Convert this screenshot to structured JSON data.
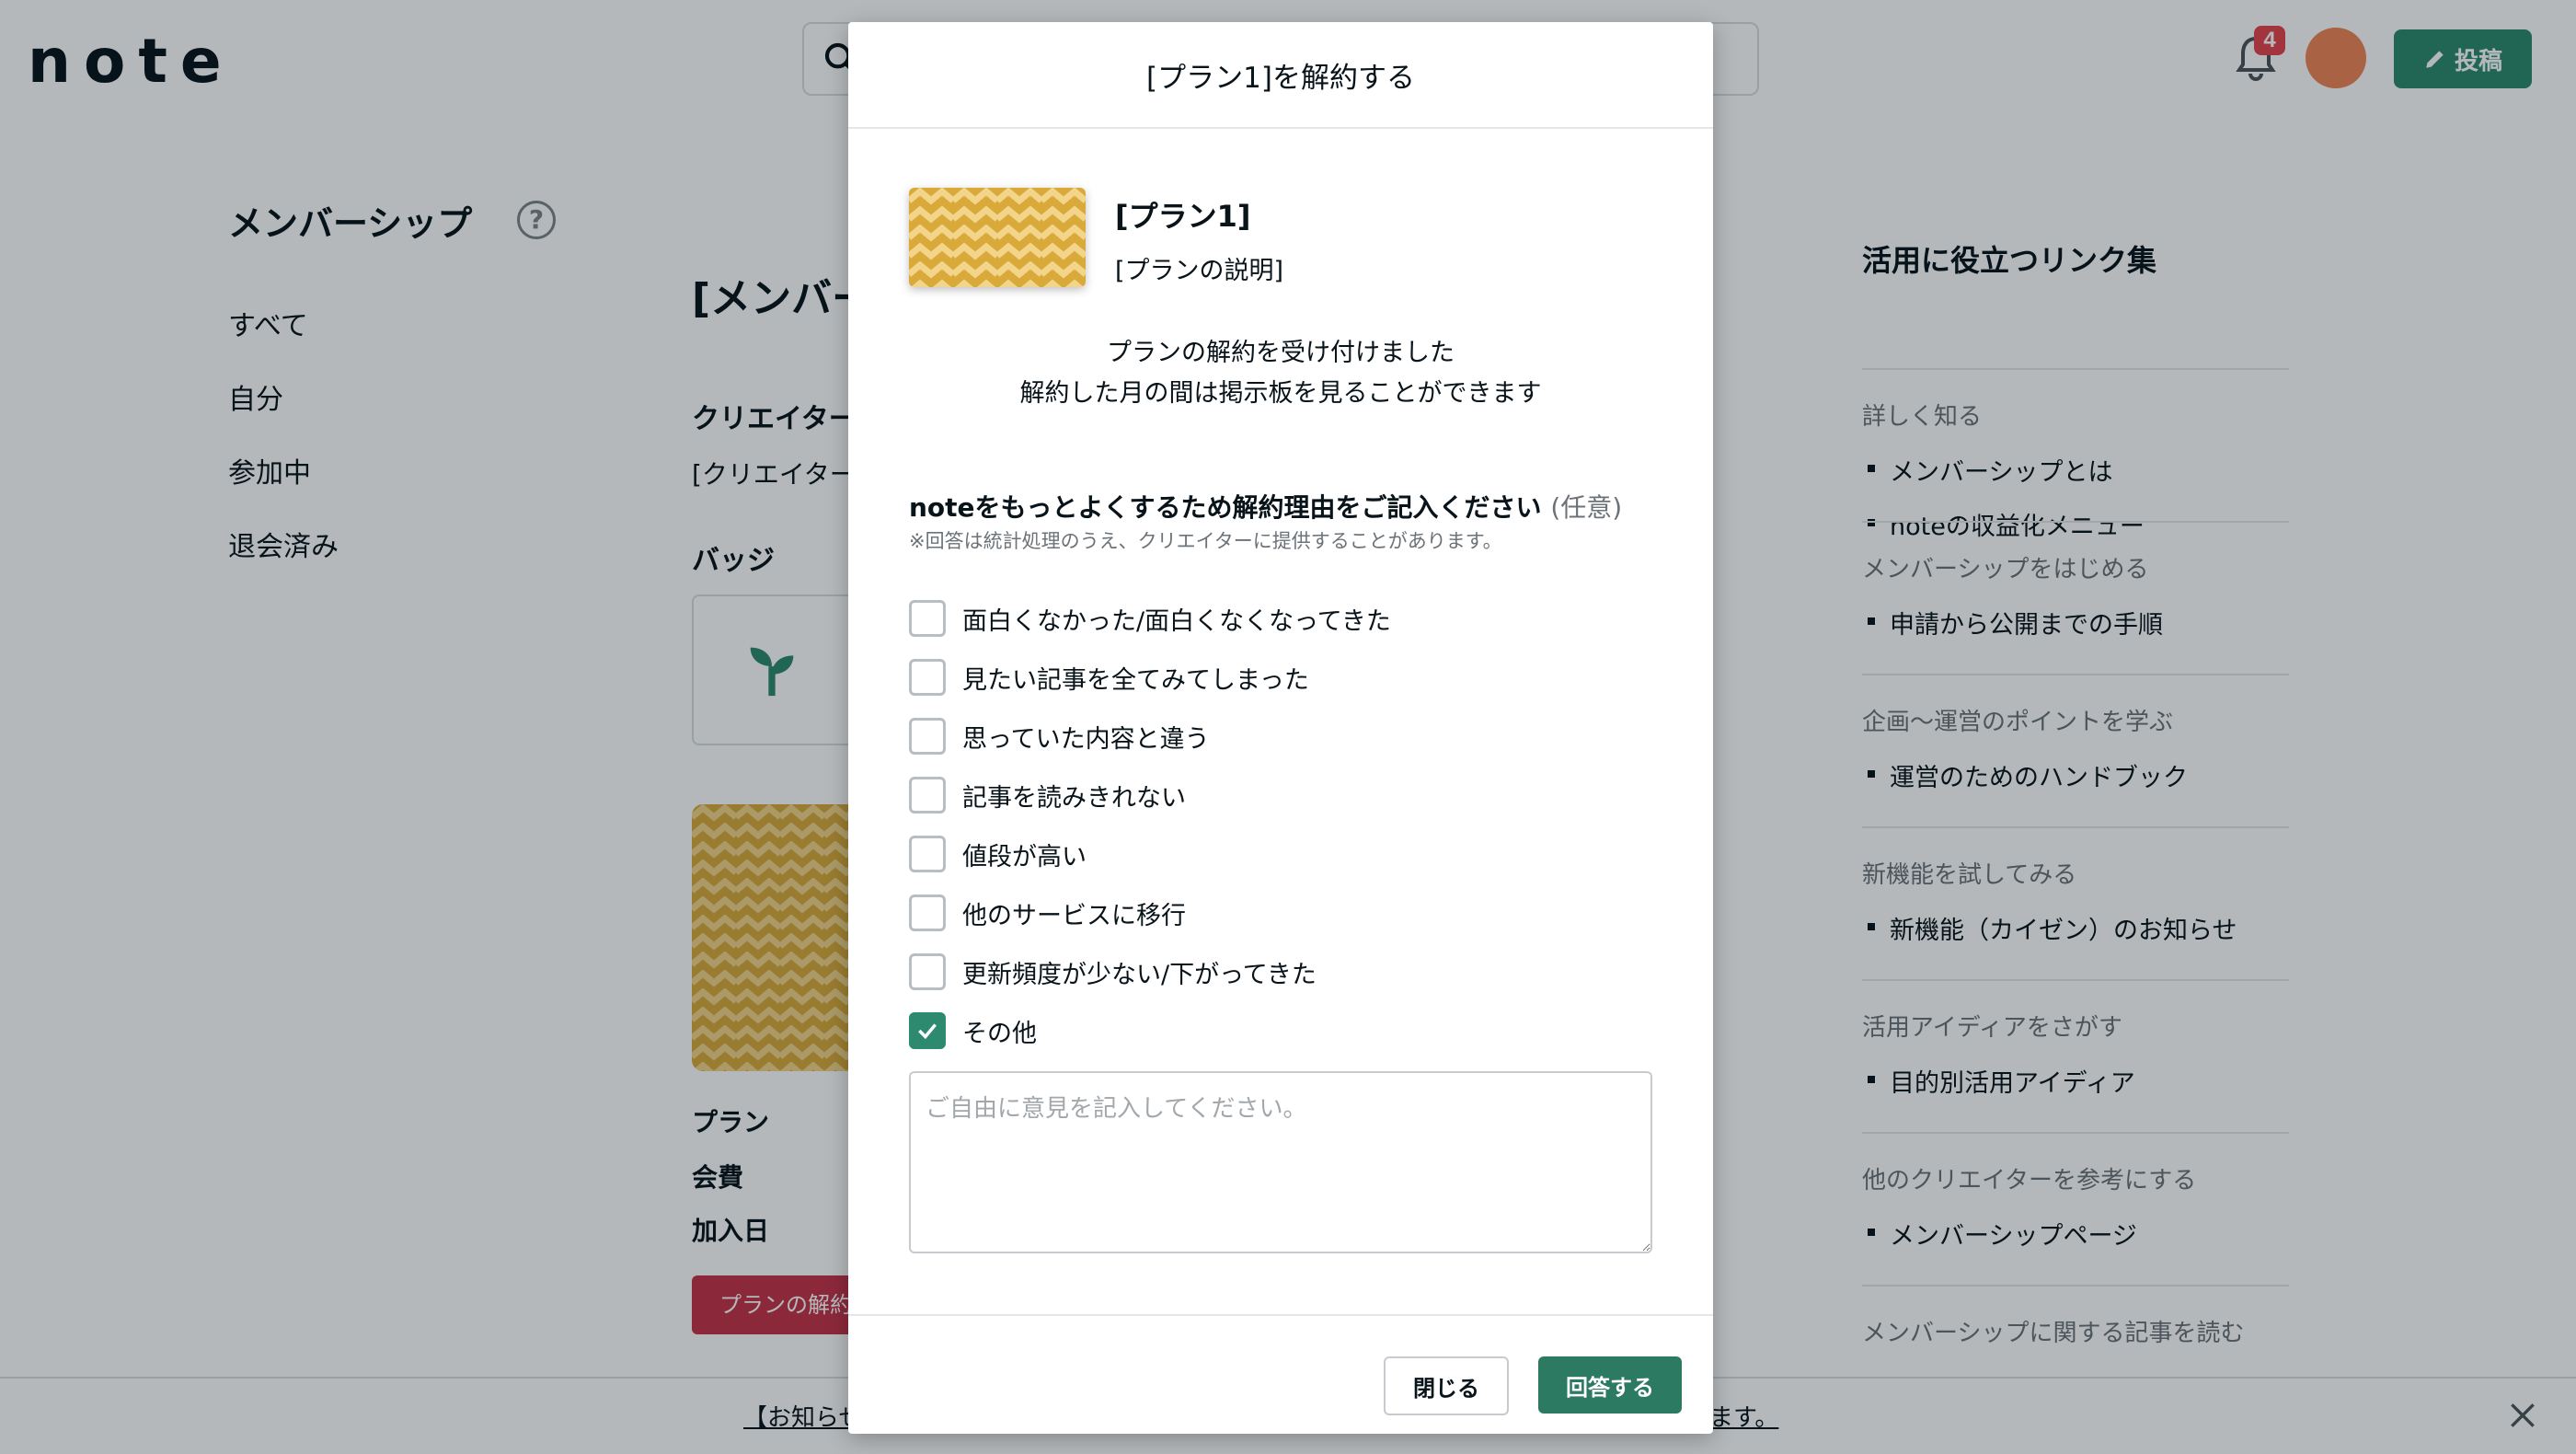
{
  "header": {
    "logo": "note",
    "notification_count": "4",
    "post_label": "投稿"
  },
  "left_nav": {
    "title": "メンバーシップ",
    "items": [
      {
        "label": "すべて"
      },
      {
        "label": "自分"
      },
      {
        "label": "参加中"
      },
      {
        "label": "退会済み"
      }
    ]
  },
  "main": {
    "title": "[メンバー",
    "creator_label": "クリエイター",
    "creator_value": "[クリエイター名",
    "badge_label": "バッジ",
    "plan_label": "プラン",
    "fee_label": "会費",
    "joined_label": "加入日",
    "cancel_button": "プランの解約"
  },
  "links": {
    "title": "活用に役立つリンク集",
    "sections": [
      {
        "heading": "詳しく知る",
        "links": [
          "メンバーシップとは",
          "noteの収益化メニュー"
        ]
      },
      {
        "heading": "メンバーシップをはじめる",
        "links": [
          "申請から公開までの手順"
        ]
      },
      {
        "heading": "企画〜運営のポイントを学ぶ",
        "links": [
          "運営のためのハンドブック"
        ]
      },
      {
        "heading": "新機能を試してみる",
        "links": [
          "新機能（カイゼン）のお知らせ"
        ]
      },
      {
        "heading": "活用アイディアをさがす",
        "links": [
          "目的別活用アイディア"
        ]
      },
      {
        "heading": "他のクリエイターを参考にする",
        "links": [
          "メンバーシップページ"
        ]
      },
      {
        "heading": "メンバーシップに関する記事を読む",
        "links": []
      }
    ]
  },
  "notice": {
    "left_text": "【お知らせ】",
    "right_text": "ます。"
  },
  "modal": {
    "title": "[プラン1]を解約する",
    "plan_name": "[プラン1]",
    "plan_description": "[プランの説明]",
    "confirm_line1": "プランの解約を受け付けました",
    "confirm_line2": "解約した月の間は掲示板を見ることができます",
    "reason_title": "noteをもっとよくするため解約理由をご記入ください",
    "reason_optional": "(任意)",
    "reason_note": "※回答は統計処理のうえ、クリエイターに提供することがあります。",
    "reasons": [
      {
        "label": "面白くなかった/面白くなくなってきた",
        "checked": false
      },
      {
        "label": "見たい記事を全てみてしまった",
        "checked": false
      },
      {
        "label": "思っていた内容と違う",
        "checked": false
      },
      {
        "label": "記事を読みきれない",
        "checked": false
      },
      {
        "label": "値段が高い",
        "checked": false
      },
      {
        "label": "他のサービスに移行",
        "checked": false
      },
      {
        "label": "更新頻度が少ない/下がってきた",
        "checked": false
      },
      {
        "label": "その他",
        "checked": true
      }
    ],
    "textarea_value": "",
    "textarea_placeholder": "ご自由に意見を記入してください。",
    "close_label": "閉じる",
    "answer_label": "回答する"
  },
  "colors": {
    "accent_green": "#2d8a6e",
    "danger_red": "#c4334a",
    "badge_red": "#e5424d",
    "pattern_gold": "#e3b54a"
  }
}
